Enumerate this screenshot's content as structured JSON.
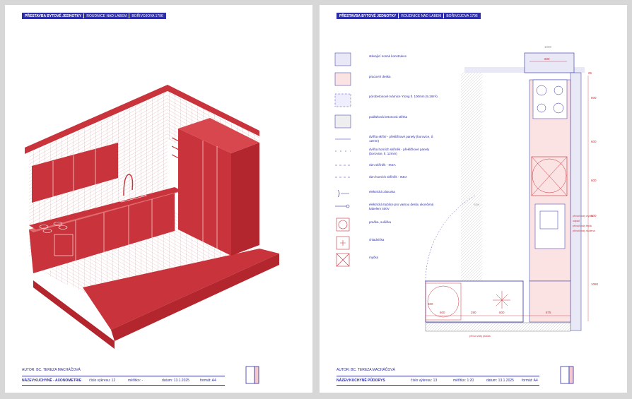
{
  "left": {
    "header": {
      "project": "PŘESTAVBA BYTOVÉ JEDNOTKY",
      "town": "ROUDNICE NAD LABEM",
      "street": "BOŘIVOJOVA 1796"
    },
    "author": "AUTOR: BC. TEREZA MACHÁČOVÁ",
    "footer": {
      "name_label": "NÁZEV:",
      "name": "KUCHYNĚ - AXONOMETRIE",
      "sheet": "číslo výkresu: 12",
      "scale": "měřítko: -",
      "date": "datum: 13.1.2025",
      "format": "formát: A4"
    }
  },
  "right": {
    "header": {
      "project": "PŘESTAVBA BYTOVÉ JEDNOTKY",
      "town": "ROUDNICE NAD LABEM",
      "street": "BOŘIVOJOVA 1796"
    },
    "author": "AUTOR: BC. TEREZA MACHÁČOVÁ",
    "footer": {
      "name_label": "NÁZEV:",
      "name": "KUCHYNĚ PŮDORYS",
      "sheet": "číslo výkresu: 13",
      "scale": "měřítko: 1:20",
      "date": "datum: 13.1.2025",
      "format": "formát: A4"
    },
    "legend": [
      "stávající nosná konstrukce",
      "pracovní deska",
      "pórobetonové tvárnice Ytong tl. 100mm (9,18m²)",
      "podlahová betonová stěrka",
      "dvířka skříní - překližkové panely (borovice, tl. 12mm)",
      "dvířka horních skříněk - překližkové panely (borovice, tl. 12mm)",
      "rám skříněk - IKEA",
      "rám horních skříněk - IKEA",
      "elektrická zásuvka",
      "elektrická tryblice pro varnou desku ukončená kabelem 400V",
      "pračka, sušička",
      "chladnička",
      "myčka"
    ],
    "dims": {
      "top_wall": "1000",
      "top_module": "600",
      "side_1": "600",
      "side_2": "600",
      "side_3": "600",
      "side_4": "600",
      "side_5": "1080",
      "side_top": "25",
      "bottom_1": "600",
      "bottom_2": "290",
      "bottom_3": "600",
      "bottom_4": "875",
      "bottom_left": "600"
    },
    "notes": [
      "přívod vody myčka",
      "odpad",
      "přívod vody teplá",
      "přívod vody studená",
      "přívod vody pračka"
    ],
    "wall_label": "SDK"
  }
}
